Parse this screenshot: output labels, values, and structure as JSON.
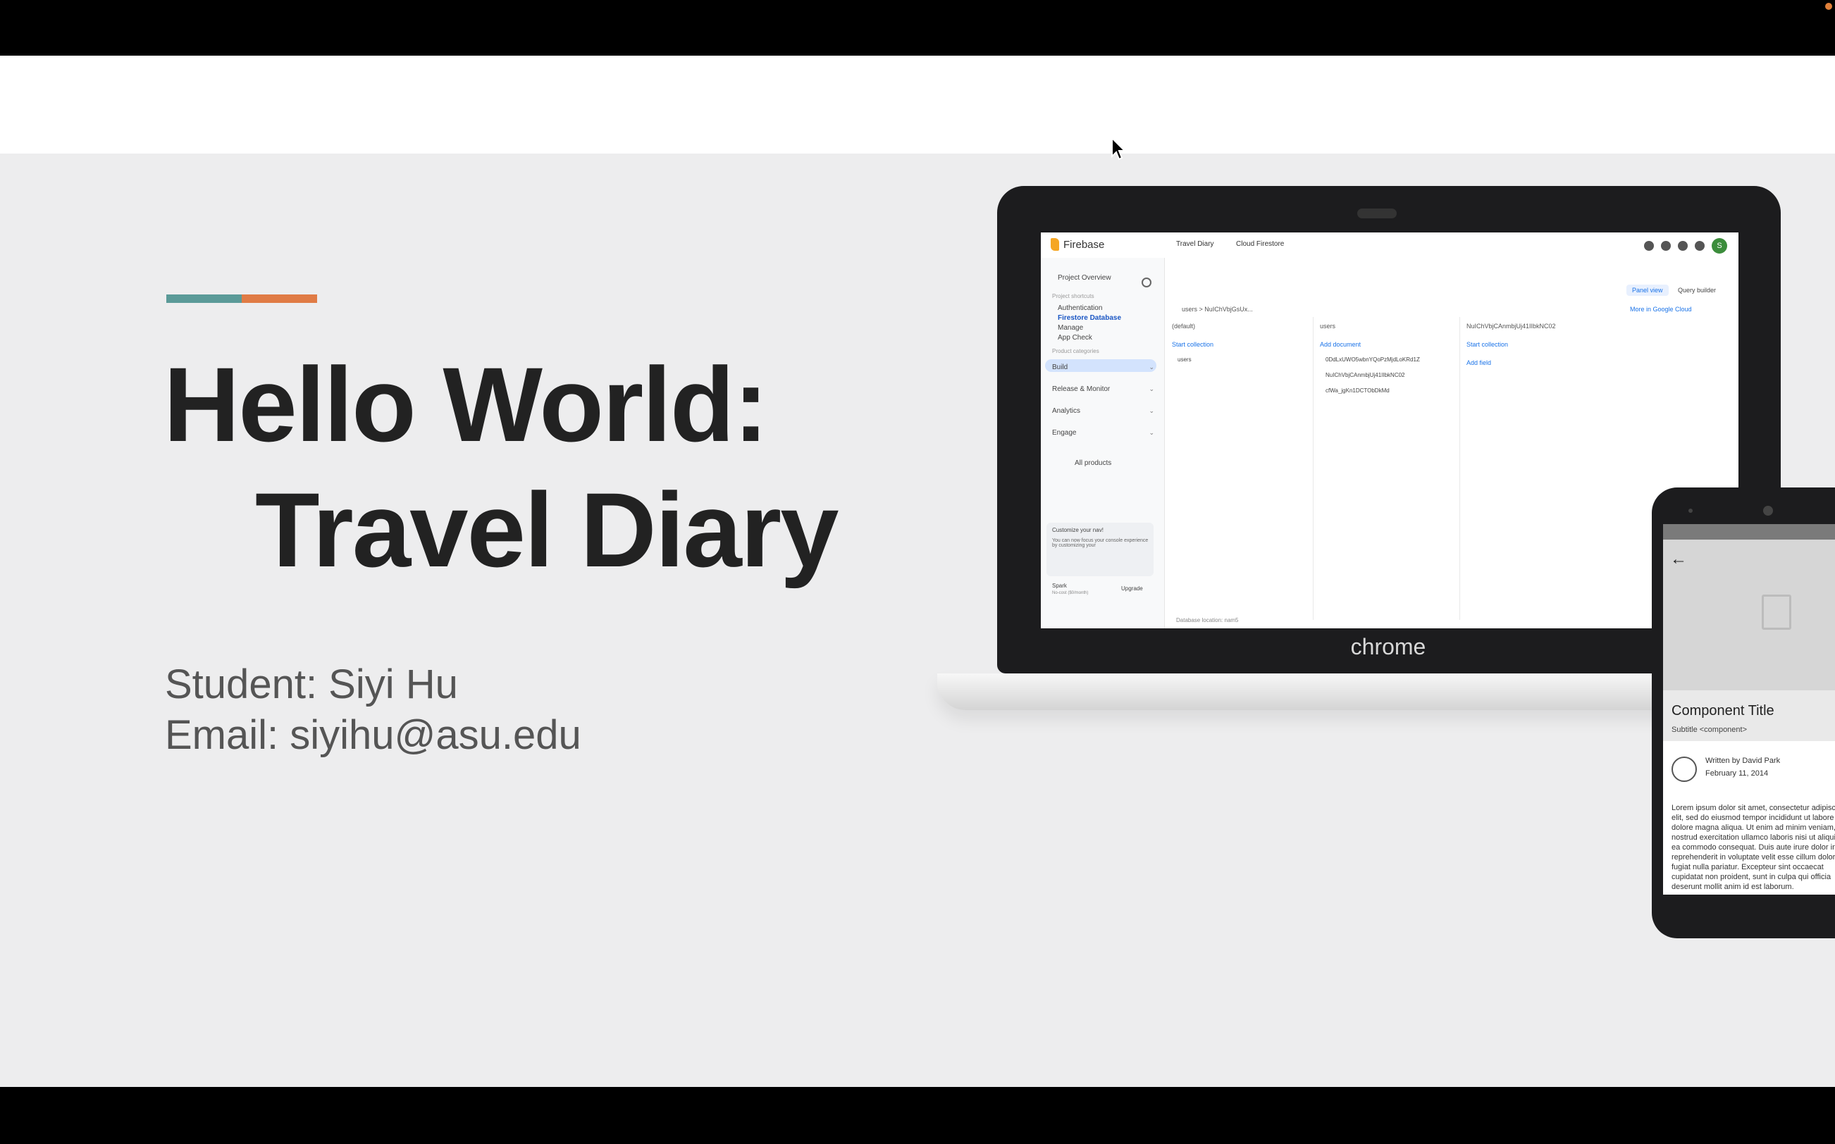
{
  "slide": {
    "title_line1": "Hello World:",
    "title_line2": "Travel Diary",
    "student": "Student: Siyi Hu",
    "email": "Email: siyihu@asu.edu",
    "accent_colors": [
      "#5b9a98",
      "#e07b45"
    ]
  },
  "laptop": {
    "brand": "chrome",
    "firebase": {
      "brand": "Firebase",
      "project": "Travel Diary",
      "product": "Cloud Firestore",
      "sidebar": {
        "project_overview": "Project Overview",
        "project_shortcuts": "Project shortcuts",
        "items": [
          "Authentication",
          "Firestore Database",
          "Manage",
          "App Check"
        ],
        "product_categories": "Product categories",
        "groups": [
          "Build",
          "Release & Monitor",
          "Analytics",
          "Engage"
        ],
        "all_products": "All products",
        "customize_title": "Customize your nav!",
        "customize_text": "You can now focus your console experience by customizing your",
        "plan": "Spark",
        "plan_sub": "No-cost ($0/month)",
        "upgrade": "Upgrade"
      },
      "main": {
        "panel_view": "Panel view",
        "query_builder": "Query builder",
        "breadcrumb": "users  >  NuIChVbjGsUx...",
        "more_in_cloud": "More in Google Cloud",
        "col1_head": "(default)",
        "col1_add": "Start collection",
        "col1_row": "users",
        "col2_head": "users",
        "col2_add": "Add document",
        "col2_rows": [
          "0DdLxUWO5wbnYQoPzMjdLoKRd1Z",
          "NuIChVbjCAnmbjUj41IIbkNC02",
          "cfWa_jgKn1DCTObDkMd"
        ],
        "col3_head": "NuIChVbjCAnmbjUj41IIbkNC02",
        "col3_add": "Start collection",
        "col3_field": "Add field",
        "footer": "Database location: nam5"
      }
    }
  },
  "phone": {
    "component_title": "Component Title",
    "subtitle": "Subtitle <component>",
    "author": "Written by David Park",
    "date": "February 11, 2014",
    "body": "Lorem ipsum dolor sit amet, consectetur adipiscing elit, sed do eiusmod tempor incididunt ut labore et dolore magna aliqua. Ut enim ad minim veniam, quis nostrud exercitation ullamco laboris nisi ut aliquip ex ea commodo consequat. Duis aute irure dolor in reprehenderit in voluptate velit esse cillum dolore eu fugiat nulla pariatur. Excepteur sint occaecat cupidatat non proident, sunt in culpa qui officia deserunt mollit anim id est laborum."
  }
}
